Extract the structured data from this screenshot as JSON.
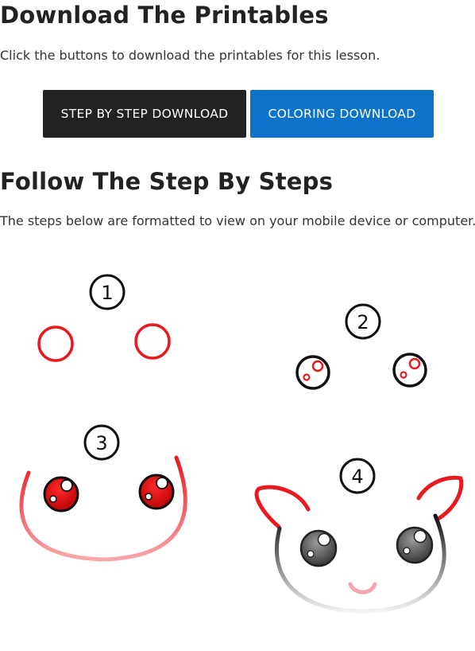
{
  "download_section": {
    "title": "Download The Printables",
    "description": "Click the buttons to download the printables for this lesson.",
    "buttons": {
      "step_by_step": "STEP BY STEP DOWNLOAD",
      "coloring": "COLORING DOWNLOAD"
    }
  },
  "steps_section": {
    "title": "Follow The Step By Steps",
    "description": "The steps below are formatted to view on your mobile device or computer.",
    "step_numbers": [
      "1",
      "2",
      "3",
      "4"
    ]
  },
  "colors": {
    "button_dark": "#222222",
    "button_blue": "#0d73c9",
    "drawing_red": "#e8191f"
  }
}
